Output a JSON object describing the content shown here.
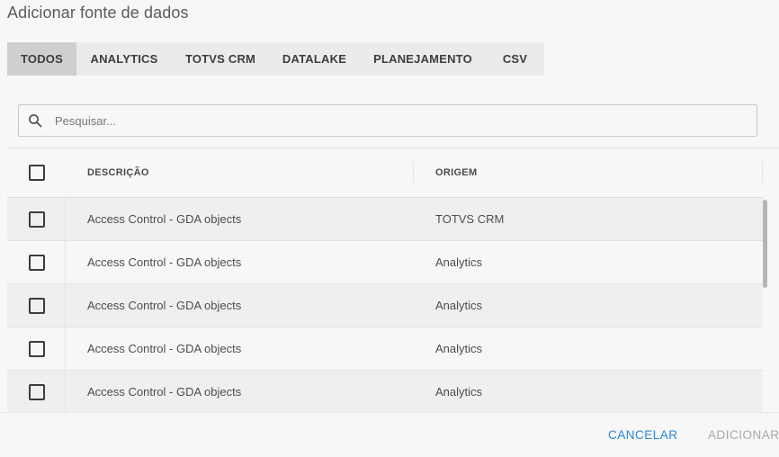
{
  "dialog": {
    "title": "Adicionar fonte de dados"
  },
  "tabs": [
    {
      "label": "TODOS",
      "active": true
    },
    {
      "label": "ANALYTICS",
      "active": false
    },
    {
      "label": "TOTVS CRM",
      "active": false
    },
    {
      "label": "DATALAKE",
      "active": false
    },
    {
      "label": "PLANEJAMENTO",
      "active": false
    },
    {
      "label": "CSV",
      "active": false
    }
  ],
  "search": {
    "placeholder": "Pesquisar...",
    "value": "",
    "icon": "search-icon"
  },
  "table": {
    "columns": {
      "description": "DESCRIÇÃO",
      "origin": "ORIGEM"
    },
    "rows": [
      {
        "description": "Access Control - GDA objects",
        "origin": "TOTVS CRM",
        "checked": false
      },
      {
        "description": "Access Control - GDA objects",
        "origin": "Analytics",
        "checked": false
      },
      {
        "description": "Access Control - GDA objects",
        "origin": "Analytics",
        "checked": false
      },
      {
        "description": "Access Control - GDA objects",
        "origin": "Analytics",
        "checked": false
      },
      {
        "description": "Access Control - GDA objects",
        "origin": "Analytics",
        "checked": false
      }
    ]
  },
  "footer": {
    "cancel_label": "CANCELAR",
    "add_label": "ADICIONAR",
    "add_enabled": false
  },
  "colors": {
    "accent": "#2a86d4",
    "disabled": "#a8a8a8",
    "active_tab": "#cfcfcf",
    "tab_bar": "#ebebeb"
  }
}
